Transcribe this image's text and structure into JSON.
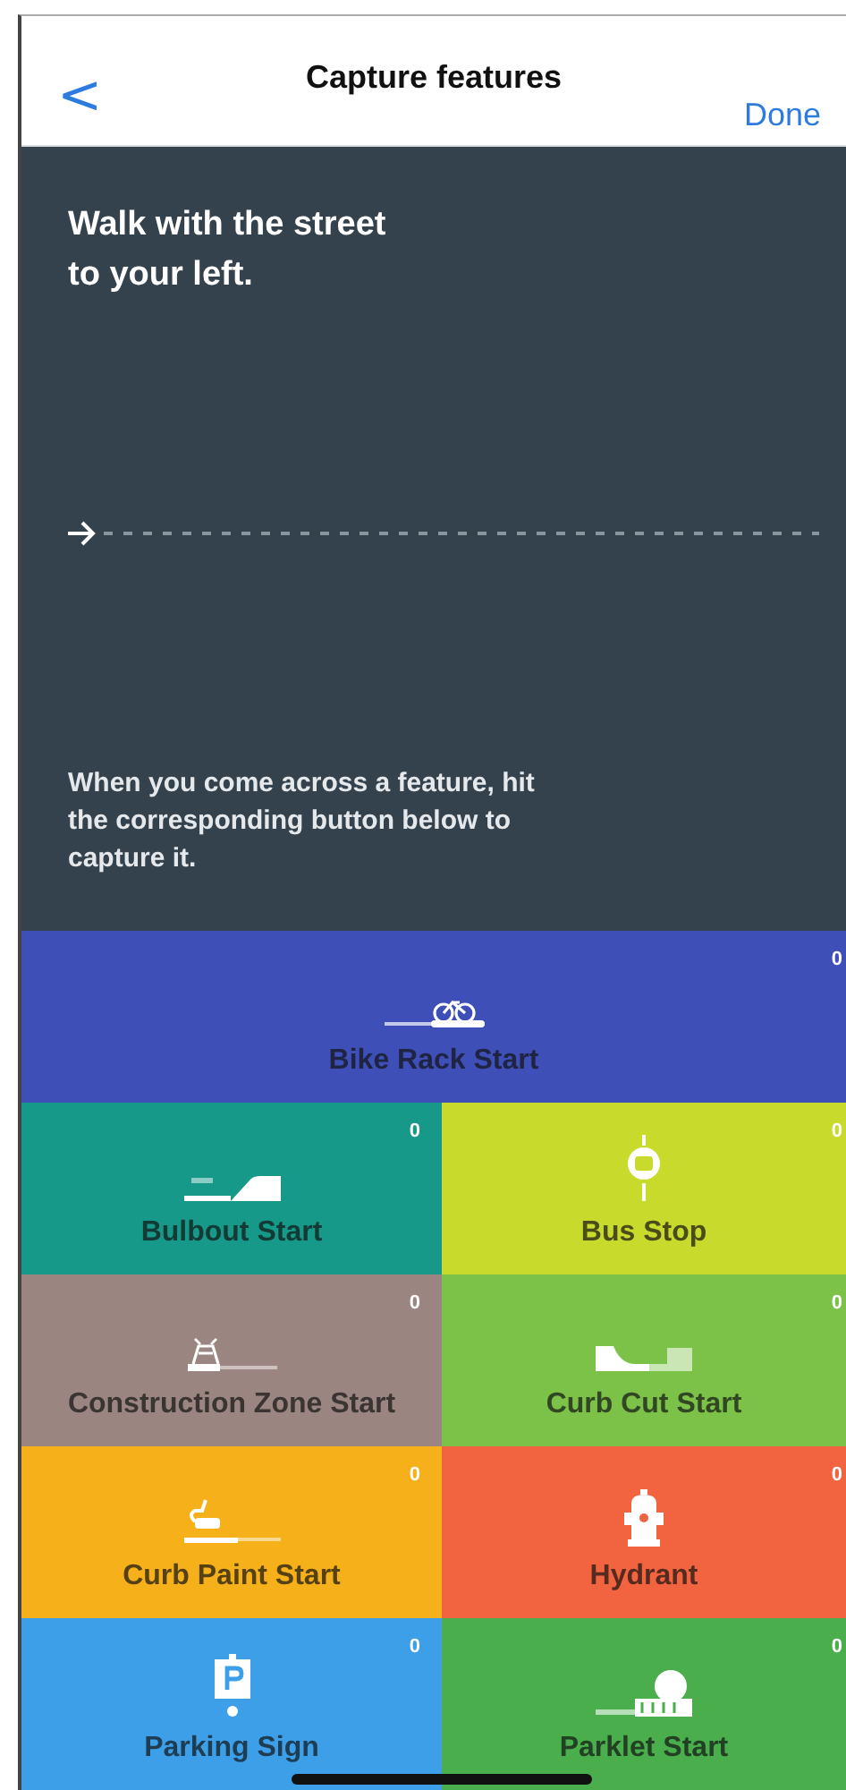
{
  "nav": {
    "back": "<",
    "title": "Capture features",
    "done": "Done"
  },
  "instructions": {
    "heading": "Walk with the street to your left.",
    "hint": "When you come across a feature, hit the corresponding button below to capture it."
  },
  "features": [
    {
      "label": "Bike Rack Start",
      "count": "0",
      "color": "#3f4fb8",
      "kind": "wide"
    },
    {
      "label": "Bulbout Start",
      "count": "0",
      "color": "#17998a",
      "kind": "half"
    },
    {
      "label": "Bus Stop",
      "count": "0",
      "color": "#c8da2c",
      "kind": "half"
    },
    {
      "label": "Construction Zone Start",
      "count": "0",
      "color": "#9a8580",
      "kind": "half"
    },
    {
      "label": "Curb Cut Start",
      "count": "0",
      "color": "#7cc148",
      "kind": "half"
    },
    {
      "label": "Curb Paint Start",
      "count": "0",
      "color": "#f6b11a",
      "kind": "half"
    },
    {
      "label": "Hydrant",
      "count": "0",
      "color": "#f26440",
      "kind": "half"
    },
    {
      "label": "Parking Sign",
      "count": "0",
      "color": "#3c9fe8",
      "kind": "half"
    },
    {
      "label": "Parklet Start",
      "count": "0",
      "color": "#4aae4c",
      "kind": "half"
    }
  ]
}
